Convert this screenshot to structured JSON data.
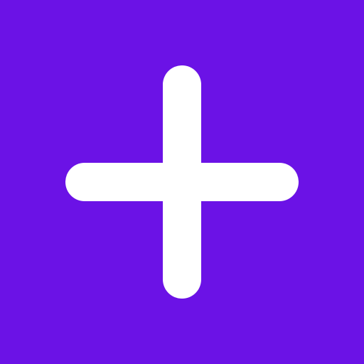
{
  "icon": {
    "name": "plus-icon"
  },
  "colors": {
    "background": "#6b12e6",
    "icon": "#ffffff"
  }
}
